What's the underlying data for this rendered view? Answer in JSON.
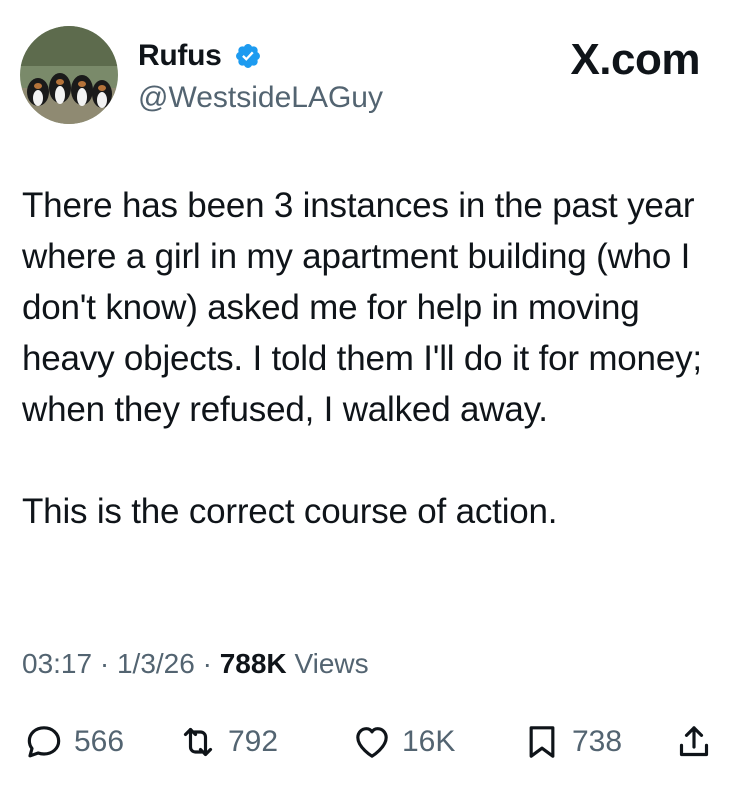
{
  "author": {
    "display_name": "Rufus",
    "handle": "@WestsideLAGuy",
    "verified": true,
    "avatar_icon": "dogs-avatar"
  },
  "brand": "X.com",
  "tweet": {
    "paragraphs": [
      "There has been 3 instances in the past year where a girl in my apartment building (who I don't know) asked me for help in moving heavy objects. I told them I'll do it for money; when they refused, I walked away.",
      "This is the correct course of action."
    ]
  },
  "meta": {
    "time": "03:17",
    "separator": "·",
    "date": "1/3/26",
    "views_count": "788K",
    "views_label": "Views"
  },
  "actions": {
    "replies": "566",
    "reposts": "792",
    "likes": "16K",
    "bookmarks": "738"
  },
  "colors": {
    "text": "#0f1419",
    "secondary": "#536471",
    "verified": "#1d9bf0"
  }
}
